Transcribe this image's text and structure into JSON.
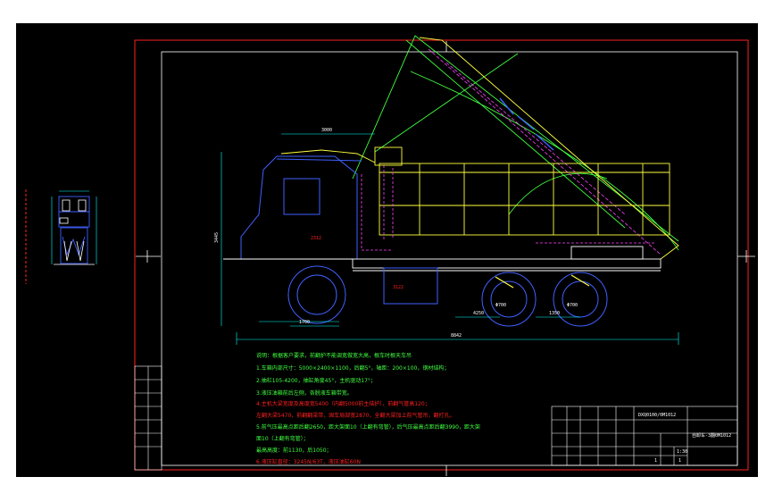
{
  "colors": {
    "background": "#ffffff",
    "viewport": "#000000",
    "outer_frame": "#ff2020",
    "inner_frame": "#ffffff",
    "truck_body": "#ffff40",
    "tipper_arc": "#40ff40",
    "chassis": "#ffffff",
    "hydraulic": "#ff40ff",
    "cab": "#4060ff",
    "wheels": "#4060ff",
    "dimension": "#00ffff",
    "notes_green": "#40ff40",
    "notes_red": "#ff2020"
  },
  "dimensions": {
    "overall_length": "8842",
    "height": "3445",
    "top_length": "3000",
    "wheelbase_front": "1700",
    "wheelbase_mid": "4250",
    "axle_rear": "1350",
    "mark_a": "2312",
    "mark_b": "3122",
    "mark_c": "2.5",
    "tire_1": "Φ700",
    "tire_2": "Φ700"
  },
  "notes": [
    "说明：根据客户要求，前翻护不能调宽做宽大高，根车时根天车吊",
    "1.车箱内部尺寸：5000×2400×1100，后翻5°，轴距：200×100，钢材结构；",
    "2.抽栏105-4200，抽缸角度45°，主机驱动17°；",
    "3.液压油箱前后左侧，各脱液车箱带宽。",
    "4.主机大梁宽度及高度宽5400（内翻5000前主结护），前翻气管高120；",
    "左翻大梁5470，前翻翻梁带，固车局部宽2870，全翻大梁加上前气管吊，翻打孔。",
    "5.前气压最高点距后翻2650，距大架面10（上翻有弯管），后气压最高点距后翻3990，距大架",
    "面10（上翻有弯管）；",
    "最高高度：前1130，后1050；",
    "6.液压缸直径：3245N/63T，液压油缸60N"
  ],
  "title_block": {
    "drawing_no": "DXQ0100/0M1012",
    "part_name": "自卸车-3翻0M1012",
    "scale": "1:30",
    "sheet": "1",
    "sheets": "1"
  },
  "revision_block": {
    "rows": [
      "标 记",
      "处 数",
      "更改文件号",
      "签 字",
      "日 期",
      "设 计",
      "审 核"
    ]
  }
}
